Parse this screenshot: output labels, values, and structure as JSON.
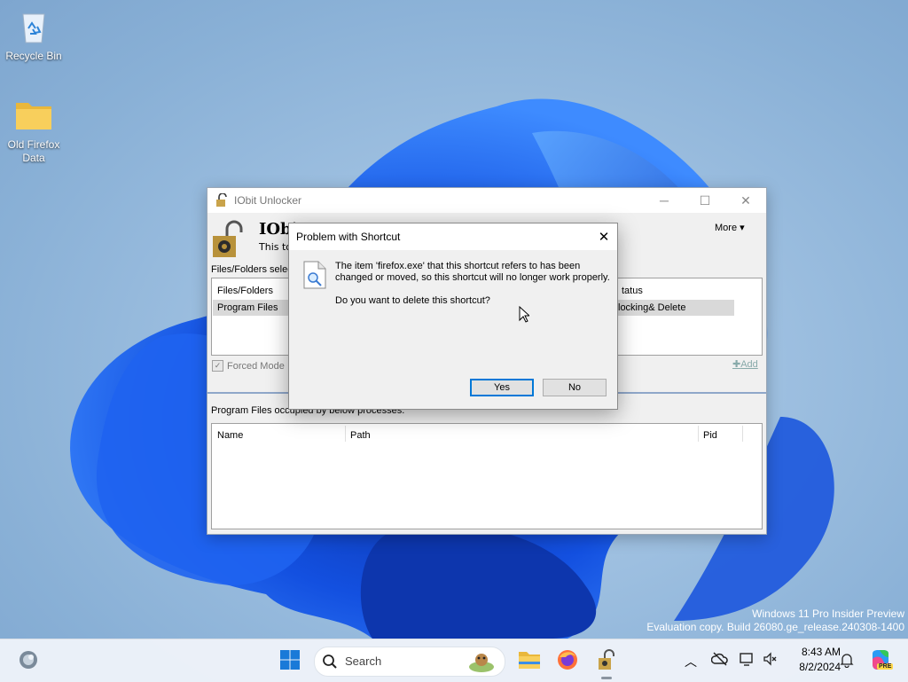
{
  "desktop": {
    "icons": [
      {
        "label": "Recycle Bin"
      },
      {
        "label": "Old Firefox Data"
      }
    ],
    "watermark": {
      "line1": "Windows 11 Pro Insider Preview",
      "line2": "Evaluation copy. Build 26080.ge_release.240308-1400"
    }
  },
  "app": {
    "title": "IObit Unlocker",
    "brand": "IObi",
    "subtitle": "This to",
    "more_label": "More",
    "files_section_label": "Files/Folders selec",
    "files_table": {
      "headers": [
        "Files/Folders",
        "tatus"
      ],
      "rows": [
        {
          "name": "Program Files",
          "status": "locking& Delete"
        }
      ]
    },
    "forced_mode_label": "Forced Mode",
    "add_label": "Add",
    "processes_label": "Program Files occupied by below processes.",
    "process_table": {
      "headers": [
        "Name",
        "Path",
        "Pid"
      ]
    }
  },
  "dialog": {
    "title": "Problem with Shortcut",
    "message_line1": "The item 'firefox.exe' that this shortcut refers to has been",
    "message_line2": "changed or moved, so this shortcut will no longer work properly.",
    "question": "Do you want to delete this shortcut?",
    "yes_label": "Yes",
    "no_label": "No"
  },
  "taskbar": {
    "search_placeholder": "Search",
    "time": "8:43 AM",
    "date": "8/2/2024",
    "copilot_badge": "PRE"
  },
  "colors": {
    "accent": "#0078d7",
    "bloom_dark": "#0a3fbf",
    "bloom_light": "#2f7dff"
  }
}
